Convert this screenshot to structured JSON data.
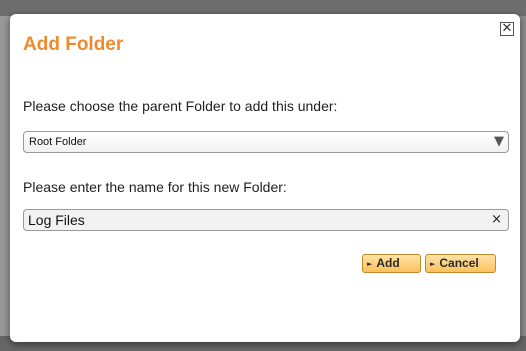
{
  "dialog": {
    "title": "Add Folder",
    "close_symbol": "✕",
    "parent_label": "Please choose the parent Folder to add this under:",
    "parent_select": {
      "selected": "Root Folder",
      "arrow_symbol": "▼"
    },
    "name_label": "Please enter the name for this new Folder:",
    "name_input": {
      "value": "Log Files",
      "clear_symbol": "×"
    },
    "buttons": {
      "add_label": "Add",
      "cancel_label": "Cancel",
      "arrow_symbol": "►"
    }
  },
  "colors": {
    "title": "#ef8a2f",
    "button_top": "#ffe3a6",
    "button_bottom": "#f9c25c",
    "button_border": "#c08a2a"
  },
  "icons": {
    "close": "close-icon",
    "select_arrow": "chevron-down-icon",
    "clear": "clear-icon",
    "button_arrow": "play-arrow-icon"
  }
}
